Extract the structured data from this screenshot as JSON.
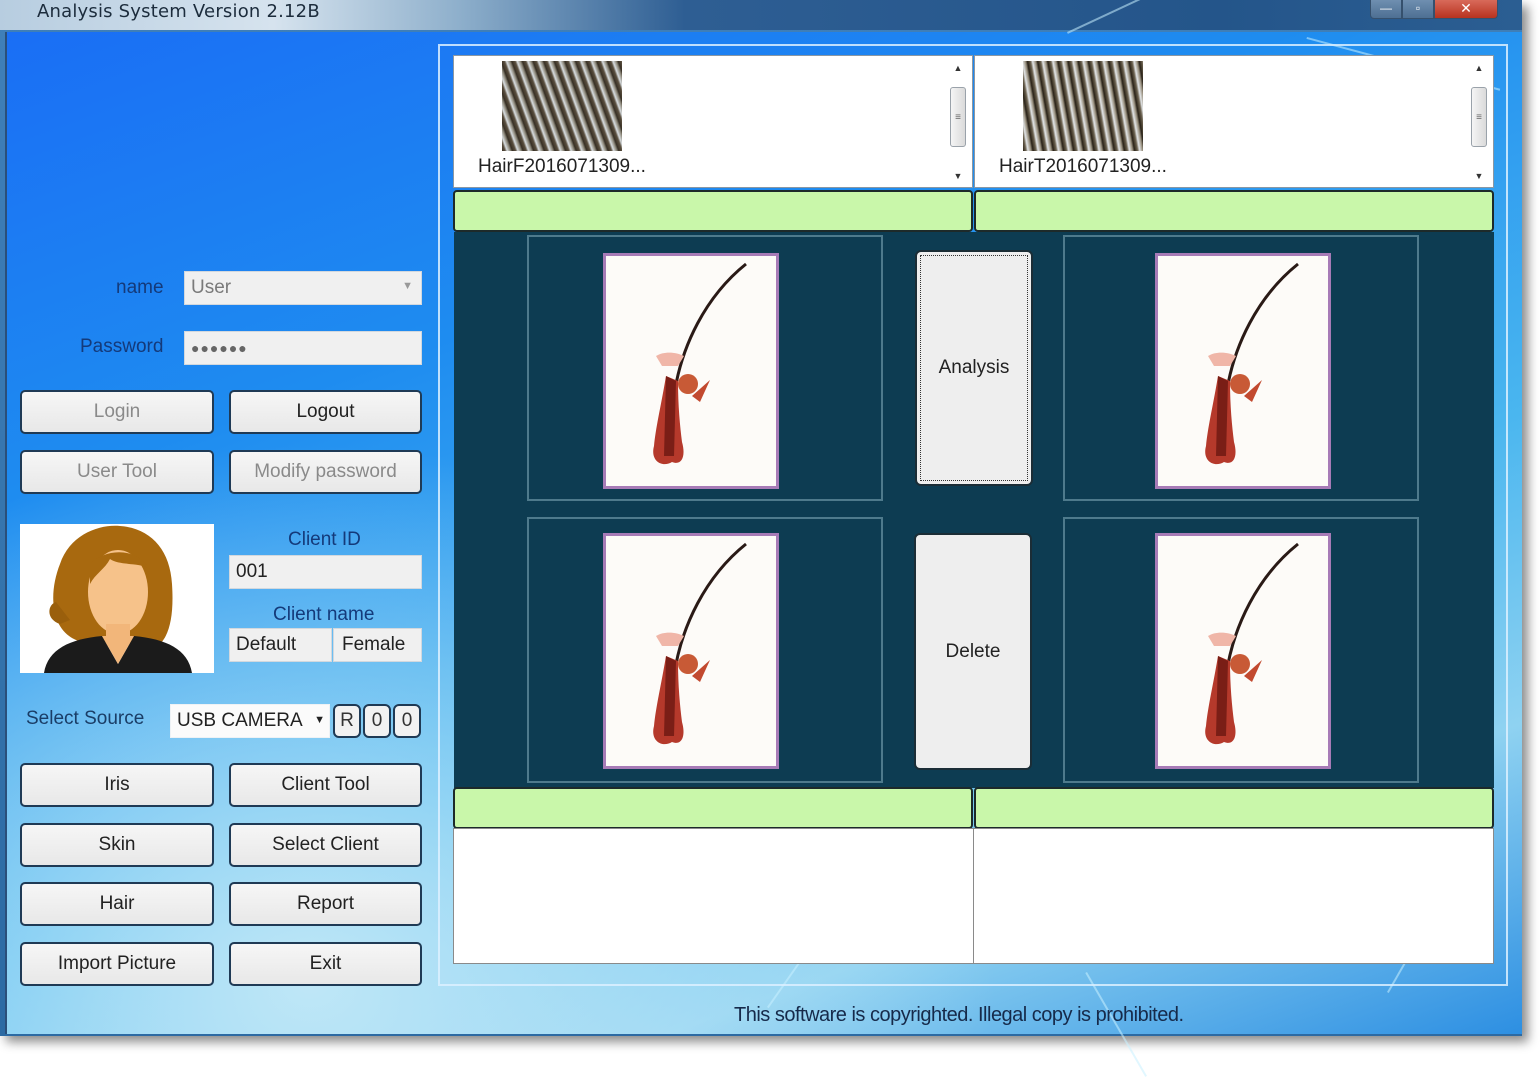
{
  "window": {
    "title": "Analysis System Version 2.12B",
    "controls": {
      "minimize": "—",
      "maximize": "▫",
      "close": "✕"
    }
  },
  "login": {
    "name_label": "name",
    "name_value": "User",
    "password_label": "Password",
    "password_value": "●●●●●●",
    "login_button": "Login",
    "logout_button": "Logout",
    "user_tool_button": "User Tool",
    "modify_password_button": "Modify password"
  },
  "client": {
    "client_id_label": "Client ID",
    "client_id_value": "001",
    "client_name_label": "Client name",
    "client_name_value": "Default",
    "client_gender_value": "Female"
  },
  "source": {
    "label": "Select Source",
    "selected": "USB CAMERA",
    "buttons": [
      "R",
      "0",
      "0"
    ]
  },
  "actions": {
    "iris": "Iris",
    "client_tool": "Client Tool",
    "skin": "Skin",
    "select_client": "Select Client",
    "hair": "Hair",
    "report": "Report",
    "import_picture": "Import Picture",
    "exit": "Exit"
  },
  "thumbnails": {
    "left": {
      "name": "HairF2016071309..."
    },
    "right": {
      "name": "HairT2016071309..."
    }
  },
  "center": {
    "analysis_button": "Analysis",
    "delete_button": "Delete"
  },
  "colors": {
    "status_bar_green": "#c9f7aa",
    "image_area_bg": "#0d3c52",
    "card_border": "#a77bb7"
  },
  "footer": {
    "copyright": "This software is copyrighted. Illegal copy is prohibited."
  }
}
